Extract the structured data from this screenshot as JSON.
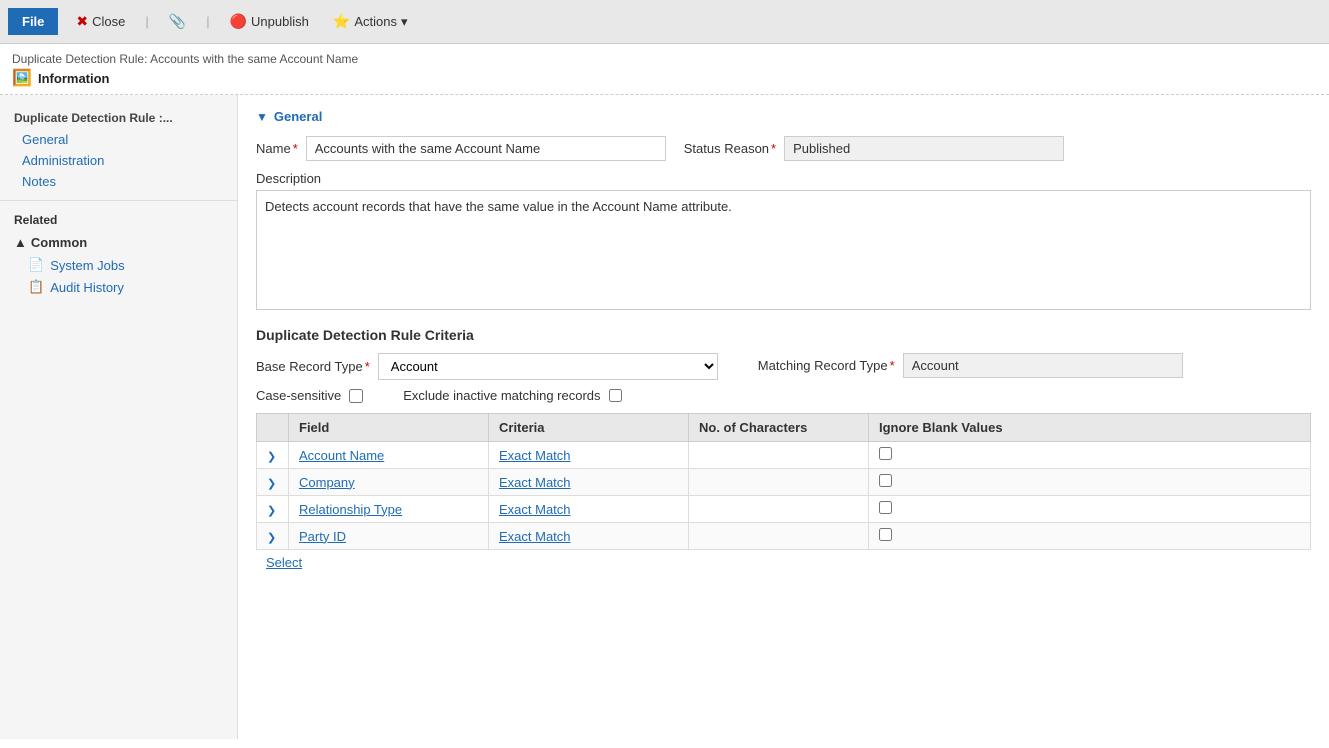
{
  "toolbar": {
    "file_label": "File",
    "close_label": "Close",
    "attach_label": "",
    "unpublish_label": "Unpublish",
    "actions_label": "Actions",
    "actions_dropdown": "▾"
  },
  "header": {
    "breadcrumb": "Duplicate Detection Rule: Accounts with the same Account Name",
    "title": "Information",
    "icon": "📋"
  },
  "sidebar": {
    "section_title": "Duplicate Detection Rule :...",
    "nav_items": [
      {
        "label": "General",
        "id": "general"
      },
      {
        "label": "Administration",
        "id": "administration"
      },
      {
        "label": "Notes",
        "id": "notes"
      }
    ],
    "related_title": "Related",
    "common_group": {
      "label": "Common",
      "items": [
        {
          "label": "System Jobs",
          "id": "system-jobs",
          "icon": "📄"
        },
        {
          "label": "Audit History",
          "id": "audit-history",
          "icon": "📋"
        }
      ]
    }
  },
  "general_section": {
    "title": "General",
    "name_label": "Name",
    "name_value": "Accounts with the same Account Name",
    "name_placeholder": "Accounts with the same Account Name",
    "status_reason_label": "Status Reason",
    "status_reason_value": "Published",
    "description_label": "Description",
    "description_value": "Detects account records that have the same value in the Account Name attribute."
  },
  "criteria_section": {
    "title": "Duplicate Detection Rule Criteria",
    "base_record_type_label": "Base Record Type",
    "base_record_type_value": "Account",
    "matching_record_type_label": "Matching Record Type",
    "matching_record_type_value": "Account",
    "case_sensitive_label": "Case-sensitive",
    "exclude_inactive_label": "Exclude inactive matching records",
    "table_headers": [
      "",
      "Field",
      "Criteria",
      "No. of Characters",
      "Ignore Blank Values"
    ],
    "table_rows": [
      {
        "field": "Account Name",
        "criteria": "Exact Match",
        "chars": "",
        "ignore_blank": false
      },
      {
        "field": "Company",
        "criteria": "Exact Match",
        "chars": "",
        "ignore_blank": false
      },
      {
        "field": "Relationship Type",
        "criteria": "Exact Match",
        "chars": "",
        "ignore_blank": false
      },
      {
        "field": "Party ID",
        "criteria": "Exact Match",
        "chars": "",
        "ignore_blank": false
      }
    ],
    "select_label": "Select"
  }
}
